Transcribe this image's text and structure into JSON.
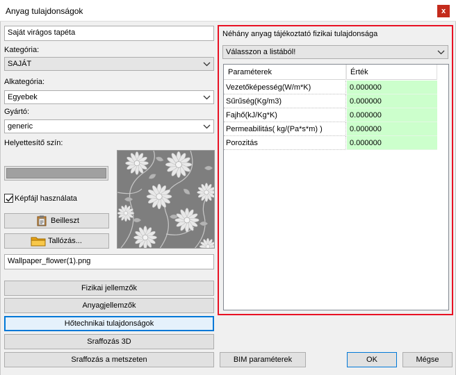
{
  "window": {
    "title": "Anyag tulajdonságok",
    "close_glyph": "x"
  },
  "left": {
    "material_name": "Saját virágos tapéta",
    "category_label": "Kategória:",
    "category_value": "SAJÁT",
    "subcategory_label": "Alkategória:",
    "subcategory_value": "Egyebek",
    "manufacturer_label": "Gyártó:",
    "manufacturer_value": "generic",
    "substitute_color_label": "Helyettesítő szín:",
    "use_image_label": "Képfájl használata",
    "use_image_checked": true,
    "paste_button": "Beilleszt",
    "browse_button": "Tallózás...",
    "image_file": "Wallpaper_flower(1).png",
    "substitute_color": "#a0a0a0"
  },
  "buttons": {
    "physical": "Fizikai jellemzők",
    "material": "Anyagjellemzők",
    "thermal": "Hőtechnikai tulajdonságok",
    "hatch_3d": "Sraffozás 3D",
    "hatch_section": "Sraffozás a metszeten",
    "bim": "BIM paraméterek",
    "ok": "OK",
    "cancel": "Mégse"
  },
  "right": {
    "heading": "Néhány anyag tájékoztató fizikai tulajdonsága",
    "select_value": "Válasszon a listából!",
    "columns": [
      "Paraméterek",
      "Érték"
    ],
    "rows": [
      {
        "name": "Vezetőképesség(W/m*K)",
        "value": "0.000000"
      },
      {
        "name": "Sűrűség(Kg/m3)",
        "value": "0.000000"
      },
      {
        "name": "Fajhő(kJ/Kg*K)",
        "value": "0.000000"
      },
      {
        "name": "Permeabilitás( kg/(Pa*s*m) )",
        "value": "0.000000"
      },
      {
        "name": "Porozitás",
        "value": "0.000000"
      }
    ]
  },
  "colors": {
    "highlight_border": "#e81123",
    "value_cell": "#ccffcc",
    "focus_blue": "#0078d7"
  },
  "icons": [
    "close-icon",
    "chevron-down-icon",
    "checkmark-icon",
    "clipboard-icon",
    "folder-icon",
    "flower-texture-image"
  ]
}
